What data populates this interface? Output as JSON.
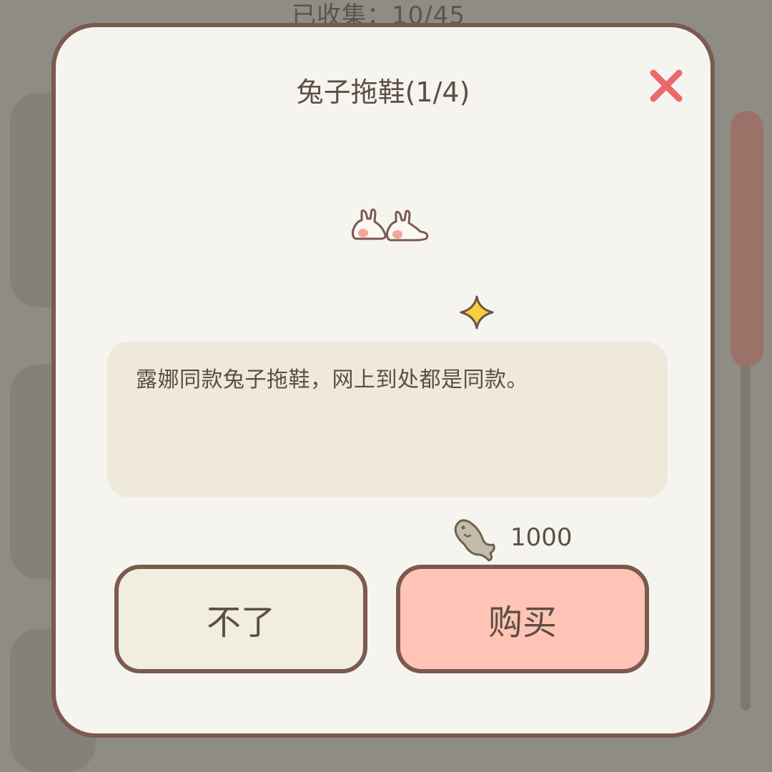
{
  "background": {
    "header_text": "已收集：10/45"
  },
  "dialog": {
    "title": "兔子拖鞋(1/4)",
    "close_icon": "close-icon",
    "item_icon": "bunny-slippers-icon",
    "sparkle_icon": "sparkle-icon",
    "description": "露娜同款兔子拖鞋，网上到处都是同款。",
    "price": {
      "currency_icon": "fish-icon",
      "amount": "1000"
    },
    "buttons": {
      "cancel_label": "不了",
      "buy_label": "购买"
    }
  },
  "colors": {
    "dialog_bg": "#f6f4ef",
    "border": "#7b5a50",
    "close_red": "#e8696a",
    "buy_button": "#ffc4b5",
    "cancel_button": "#f1ede0",
    "description_bg": "#efe9dc",
    "sparkle_yellow": "#f7cf3c",
    "text": "#5c4e45"
  }
}
